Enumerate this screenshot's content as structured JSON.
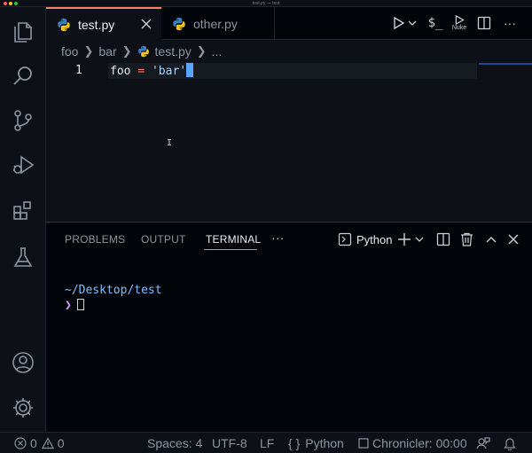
{
  "window": {
    "title": "test.py — test"
  },
  "tabs": [
    {
      "label": "test.py",
      "active": true
    },
    {
      "label": "other.py",
      "active": false
    }
  ],
  "editor_actions": {
    "run": "run-icon",
    "run_dropdown": "chevron-down-icon",
    "terminal": "$_",
    "nuke": "Nuke",
    "split": "split-editor-icon"
  },
  "breadcrumb": {
    "folder1": "foo",
    "folder2": "bar",
    "file": "test.py",
    "more": "..."
  },
  "editor": {
    "line_number": "1",
    "code": {
      "ident": "foo",
      "op": "=",
      "string": "'bar'"
    }
  },
  "panel": {
    "tabs": [
      "PROBLEMS",
      "OUTPUT",
      "TERMINAL"
    ],
    "active_tab": "TERMINAL",
    "more": "···",
    "terminal_profile": "Python"
  },
  "terminal": {
    "path": "~/Desktop/test",
    "prompt": "❯"
  },
  "statusbar": {
    "errors": "0",
    "warnings": "0",
    "spaces": "Spaces: 4",
    "encoding": "UTF-8",
    "eol": "LF",
    "language_braces": "{ }",
    "language": "Python",
    "chronicler": "Chronicler: 00:00"
  },
  "colors": {
    "accent": "#f78166",
    "cursor": "#58a6ff",
    "string": "#a5d6ff",
    "keyword": "#ff7b72",
    "terminal_path": "#79c0ff",
    "terminal_prompt": "#d2a8ff"
  }
}
